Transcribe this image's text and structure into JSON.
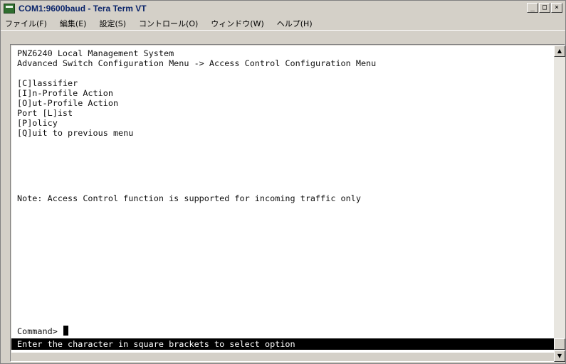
{
  "window": {
    "title": "COM1:9600baud - Tera Term VT",
    "controls": {
      "minimize": "_",
      "maximize": "□",
      "close": "×"
    }
  },
  "menubar": {
    "items": [
      {
        "label": "ファイル(F)"
      },
      {
        "label": "編集(E)"
      },
      {
        "label": "設定(S)"
      },
      {
        "label": "コントロール(O)"
      },
      {
        "label": "ウィンドウ(W)"
      },
      {
        "label": "ヘルプ(H)"
      }
    ]
  },
  "terminal": {
    "lines": [
      "PNZ6240 Local Management System",
      "Advanced Switch Configuration Menu -> Access Control Configuration Menu",
      "",
      "[C]lassifier",
      "[I]n-Profile Action",
      "[O]ut-Profile Action",
      "Port [L]ist",
      "[P]olicy",
      "[Q]uit to previous menu",
      "",
      "",
      "",
      "",
      "Note: Access Control function is supported for incoming traffic only"
    ],
    "prompt": "Command>",
    "status": "Enter the character in square brackets to select option"
  },
  "scrollbar": {
    "up": "▲",
    "down": "▼"
  }
}
